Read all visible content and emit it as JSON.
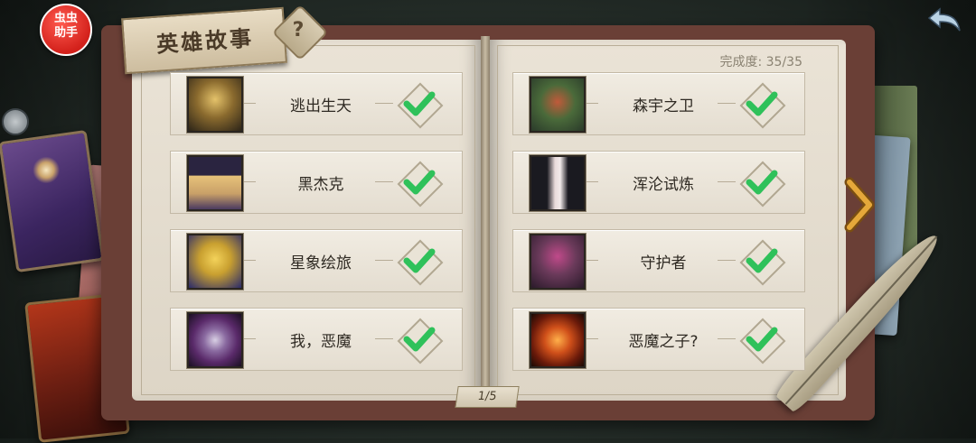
{
  "header": {
    "title": "英雄故事",
    "help_icon": "question-icon",
    "back_icon": "back-arrow-icon",
    "helper_badge": "虫虫\n助手"
  },
  "completion": {
    "label": "完成度: 35/35"
  },
  "stories_left": [
    {
      "name": "逃出生天",
      "completed": true,
      "portrait_color": "#8a6a2e"
    },
    {
      "name": "黑杰克",
      "completed": true,
      "portrait_color": "#3a3050"
    },
    {
      "name": "星象绘旅",
      "completed": true,
      "portrait_color": "#c9a030"
    },
    {
      "name": "我，恶魔",
      "completed": true,
      "portrait_color": "#5a2a6a"
    }
  ],
  "stories_right": [
    {
      "name": "森宇之卫",
      "completed": true,
      "portrait_color": "#4a6a3a"
    },
    {
      "name": "浑沦试炼",
      "completed": true,
      "portrait_color": "#2a2a30"
    },
    {
      "name": "守护者",
      "completed": true,
      "portrait_color": "#6a3a5a"
    },
    {
      "name": "恶魔之子?",
      "completed": true,
      "portrait_color": "#9a3a1a"
    }
  ],
  "pagination": {
    "label": "1/5",
    "next_icon": "chevron-right-icon"
  },
  "colors": {
    "check": "#2fc15a",
    "accent": "#e5a83a"
  }
}
